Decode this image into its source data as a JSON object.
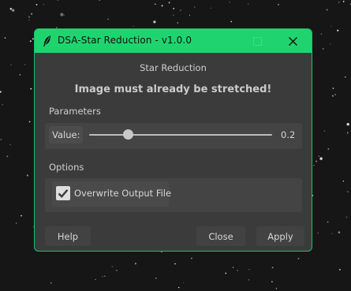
{
  "window": {
    "title": "DSA-Star Reduction - v1.0.0",
    "accent_color": "#1fd46f",
    "icons": {
      "app": "feather-icon",
      "minimize": "minimize-icon",
      "maximize": "maximize-icon",
      "close": "close-icon"
    }
  },
  "header": {
    "label": "Star Reduction",
    "warning": "Image must already be stretched!"
  },
  "parameters": {
    "group_title": "Parameters",
    "value_label": "Value:",
    "value_readout": "0.2",
    "slider_fraction": 0.21
  },
  "options": {
    "group_title": "Options",
    "overwrite_label": "Overwrite Output File",
    "overwrite_checked": true
  },
  "buttons": {
    "help": "Help",
    "close": "Close",
    "apply": "Apply"
  }
}
